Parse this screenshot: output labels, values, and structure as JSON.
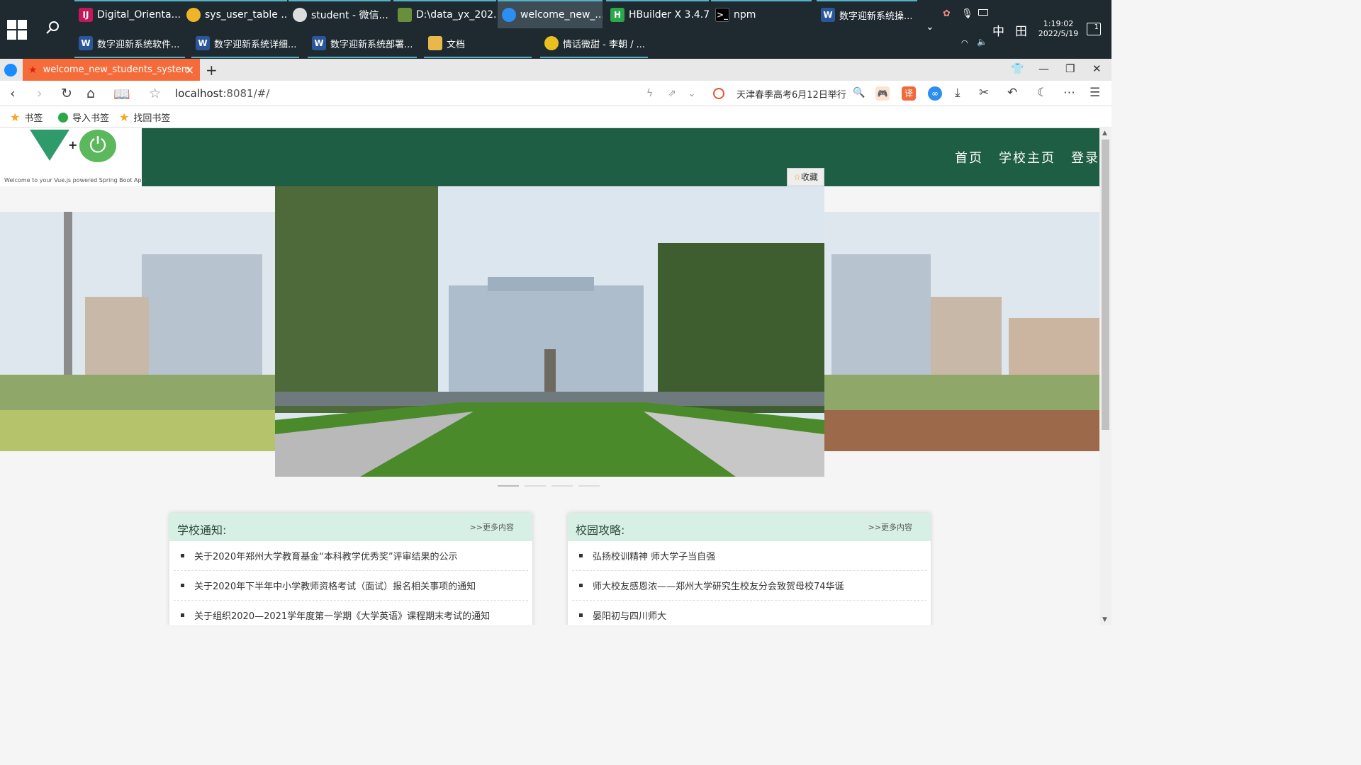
{
  "taskbar": {
    "row1": [
      {
        "label": "Digital_Orienta...",
        "icon": "idea-icon"
      },
      {
        "label": "sys_user_table ...",
        "icon": "database-icon"
      },
      {
        "label": "student - 微信...",
        "icon": "wechat-icon"
      },
      {
        "label": "D:\\data_yx_202...",
        "icon": "document-icon"
      },
      {
        "label": "welcome_new_...",
        "icon": "browser-icon"
      },
      {
        "label": "HBuilder X 3.4.7",
        "icon": "hbuilder-icon"
      },
      {
        "label": "npm",
        "icon": "terminal-icon"
      },
      {
        "label": "数字迎新系统操...",
        "icon": "word-icon"
      }
    ],
    "row2": [
      {
        "label": "数字迎新系统软件...",
        "icon": "word-icon"
      },
      {
        "label": "数字迎新系统详细...",
        "icon": "word-icon"
      },
      {
        "label": "数字迎新系统部署...",
        "icon": "word-icon"
      },
      {
        "label": "文档",
        "icon": "folder-icon"
      },
      {
        "label": "情话微甜 - 李朝 / ...",
        "icon": "music-icon"
      }
    ],
    "ime": "中",
    "time": "1:19:02",
    "date": "2022/5/19",
    "notification_count": "1"
  },
  "browser": {
    "tab_title": "welcome_new_students_system",
    "url_host": "localhost",
    "url_rest": ":8081/#/",
    "hot_search": "天津春季高考6月12日举行",
    "bookmarks": [
      {
        "label": "书签"
      },
      {
        "label": "导入书签"
      },
      {
        "label": "找回书签"
      }
    ]
  },
  "site": {
    "logo_subtitle": "Welcome to your Vue.js powered Spring Boot App",
    "nav": [
      "首页",
      "学校主页",
      "登录"
    ],
    "favorite": "收藏",
    "carousel_slides": 4,
    "carousel_active": 1
  },
  "notices": {
    "title": "学校通知:",
    "more": ">>更多内容",
    "items": [
      "关于2020年郑州大学教育基金“本科教学优秀奖”评审结果的公示",
      "关于2020年下半年中小学教师资格考试（面试）报名相关事项的通知",
      "关于组织2020—2021学年度第一学期《大学英语》课程期末考试的通知"
    ]
  },
  "guides": {
    "title": "校园攻略:",
    "more": ">>更多内容",
    "items": [
      "弘扬校训精神 师大学子当自强",
      "师大校友感恩浓——郑州大学研究生校友分会致贺母校74华诞",
      "晏阳初与四川师大"
    ]
  },
  "colors": {
    "header_green": "#1e5e45",
    "panel_head": "#d7f0e5",
    "tab_orange": "#f56b3a"
  }
}
